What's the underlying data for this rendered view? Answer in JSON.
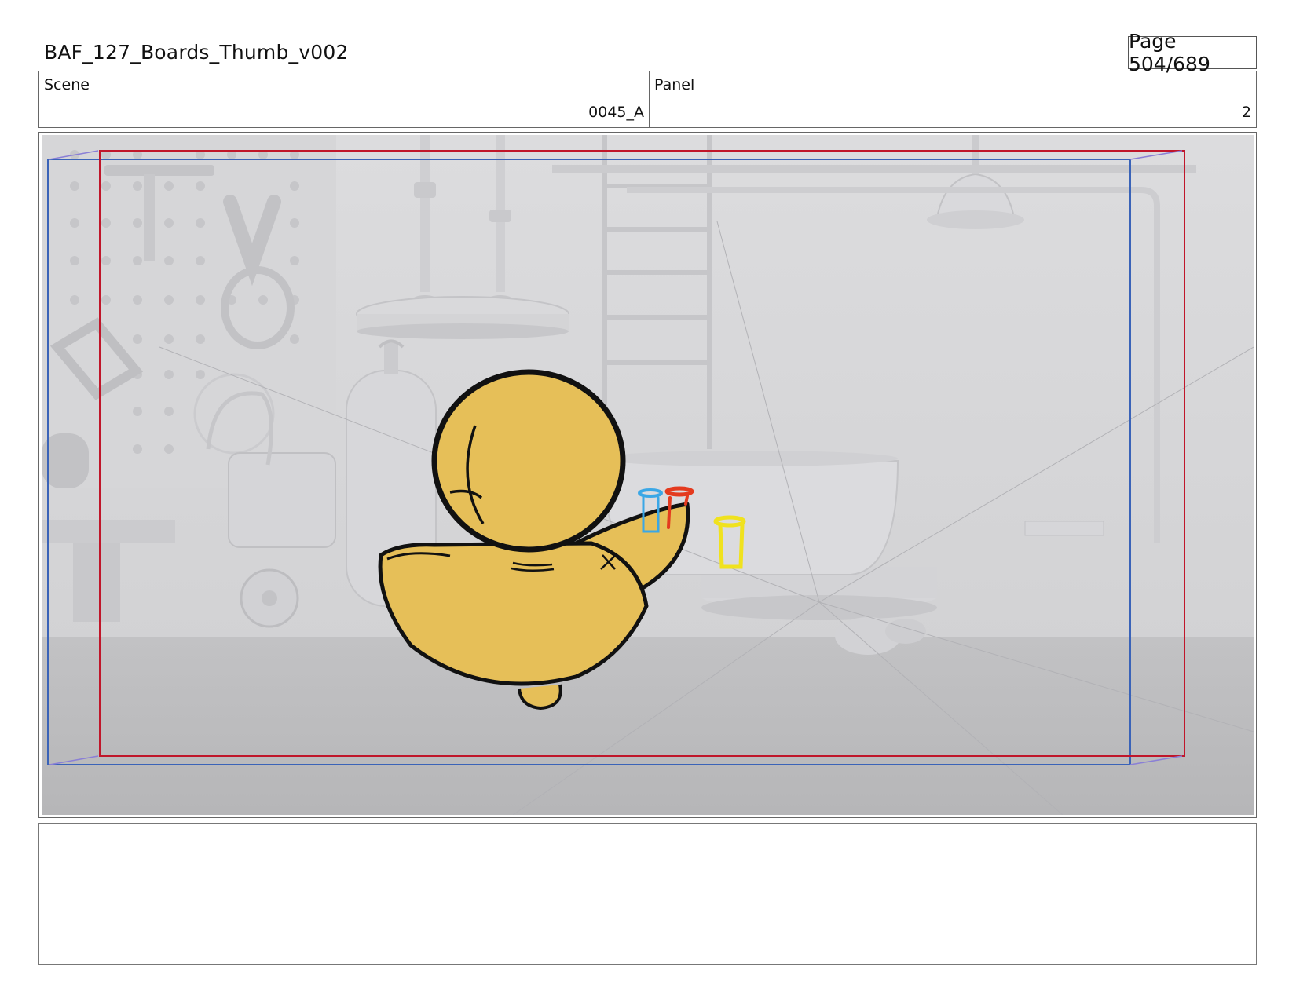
{
  "document": {
    "title": "BAF_127_Boards_Thumb_v002",
    "page_label": "Page 504/689"
  },
  "scene": {
    "label": "Scene",
    "value": "0045_A"
  },
  "panel": {
    "label": "Panel",
    "value": "2"
  },
  "notes": {
    "text": ""
  },
  "colors": {
    "safe_frame_red": "#c0162a",
    "action_frame_blue": "#3a63b8",
    "duck_yellow": "#e6bf58",
    "background_grey": "#d4d4d6"
  }
}
